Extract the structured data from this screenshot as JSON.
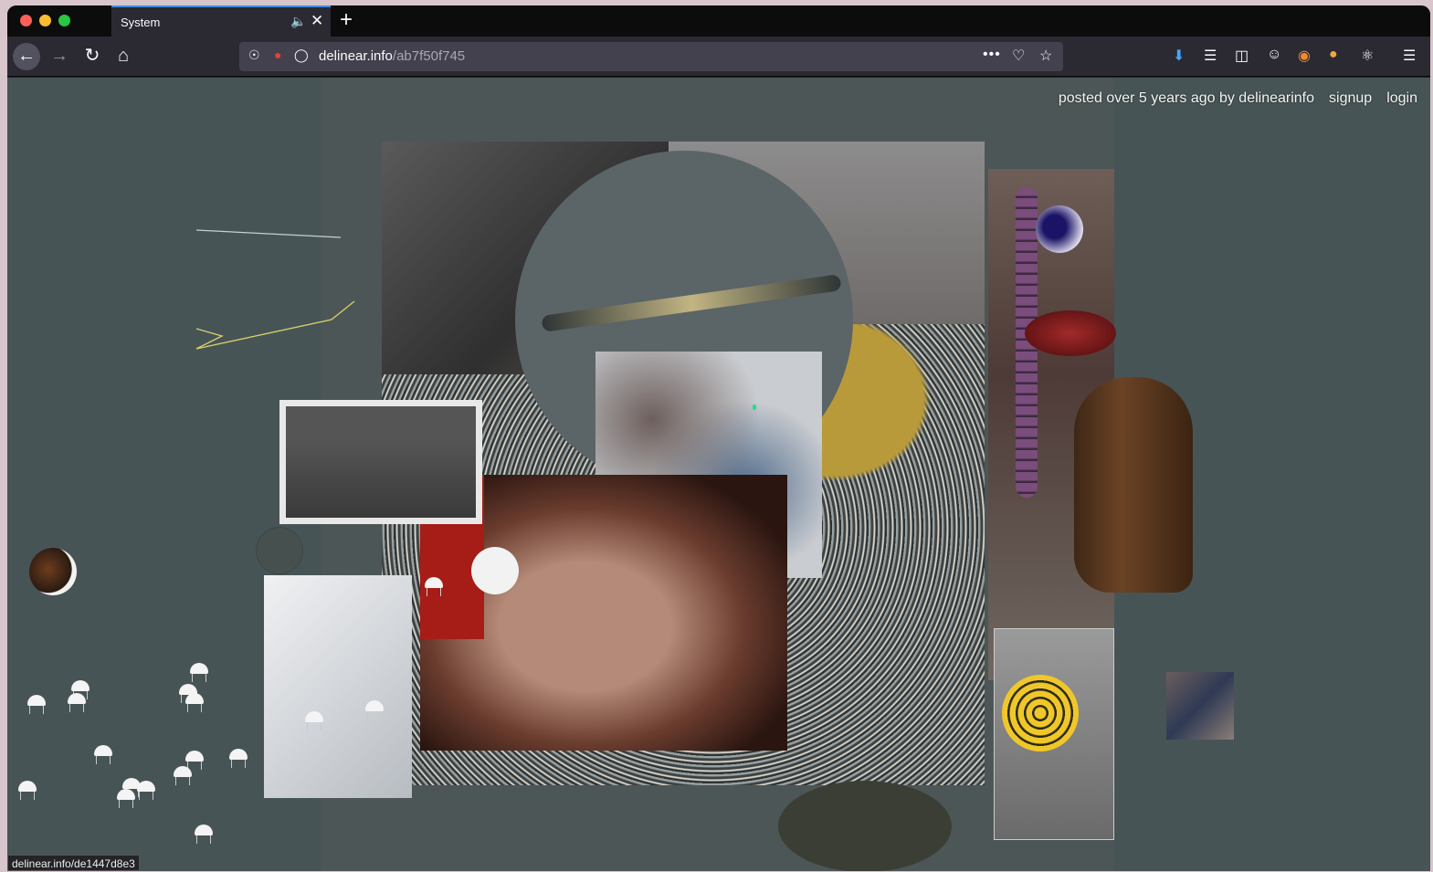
{
  "browser": {
    "tab_title": "System",
    "url_host": "delinear.info",
    "url_path": "/ab7f50f745",
    "url_menu_glyph": "•••"
  },
  "page": {
    "posted_text": "posted over 5 years ago by delinearinfo",
    "signup_label": "signup",
    "login_label": "login"
  },
  "status_bar": {
    "url": "delinear.info/de1447d8e3"
  },
  "icons": {
    "back": "back-arrow-icon",
    "forward": "forward-arrow-icon",
    "reload": "reload-icon",
    "home": "home-icon",
    "shield": "shield-icon",
    "permissions": "permissions-icon",
    "pocket": "pocket-icon",
    "bookmark": "star-icon",
    "download": "download-icon",
    "library": "library-icon",
    "sidebar": "sidebar-icon",
    "account": "account-icon",
    "menu": "hamburger-menu-icon"
  },
  "colors": {
    "page_background": "#475456",
    "tab_accent": "#3e8ee6",
    "download_accent": "#3fa8ff"
  }
}
